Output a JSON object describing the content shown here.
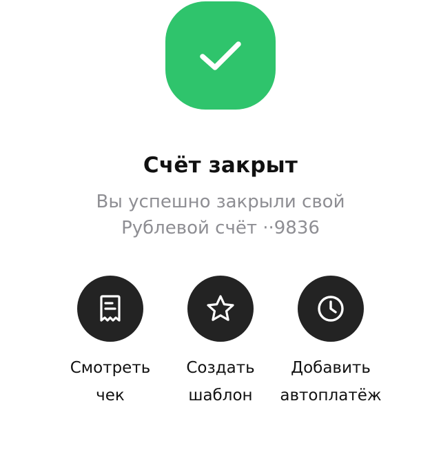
{
  "status": {
    "icon": "checkmark-icon",
    "badge_color": "#2fc46c",
    "title": "Счёт закрыт",
    "subtitle_line1": "Вы успешно закрыли свой",
    "subtitle_line2": "Рублевой счёт ··9836"
  },
  "actions": [
    {
      "icon": "receipt-icon",
      "label_line1": "Смотреть",
      "label_line2": "чек"
    },
    {
      "icon": "star-icon",
      "label_line1": "Создать",
      "label_line2": "шаблон"
    },
    {
      "icon": "clock-icon",
      "label_line1": "Добавить",
      "label_line2": "автоплатёж"
    }
  ],
  "colors": {
    "action_circle": "#232323",
    "subtitle_text": "#8e8e93",
    "title_text": "#111111"
  }
}
